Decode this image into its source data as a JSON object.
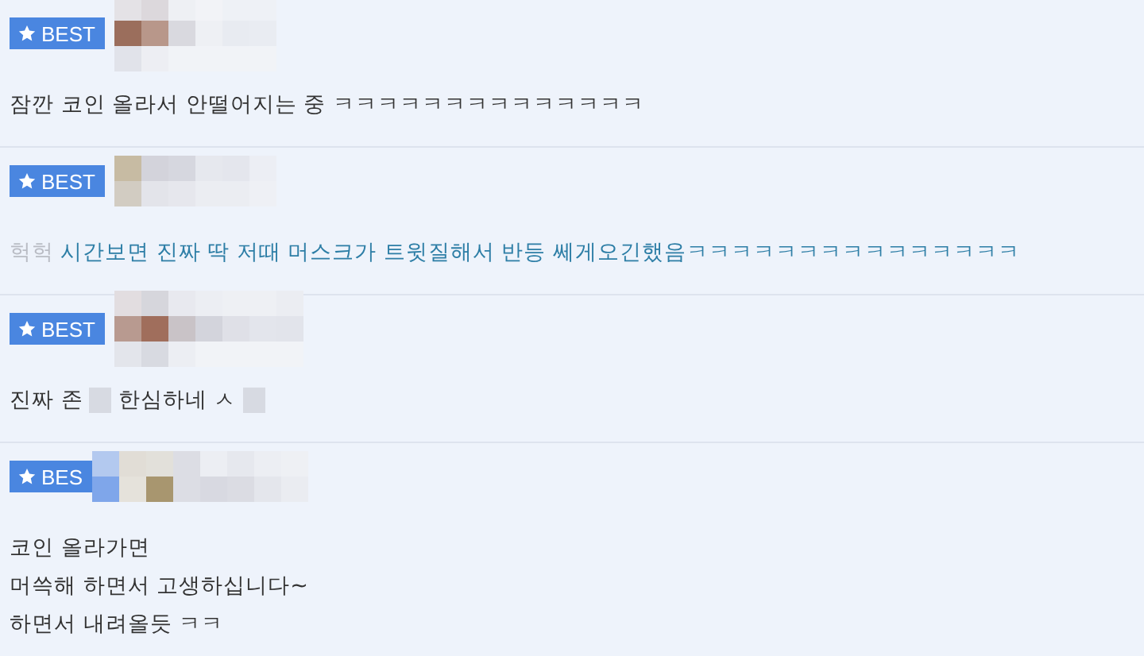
{
  "comments": [
    {
      "badge": "BEST",
      "lines": [
        [
          {
            "kind": "text",
            "text": "잠깐 코인 올라서 안떨어지는 중 ㅋㅋㅋㅋㅋㅋㅋㅋㅋㅋㅋㅋㅋㅋ"
          }
        ]
      ]
    },
    {
      "badge": "BEST",
      "lines": [
        [
          {
            "kind": "muted",
            "text": "헉헉"
          },
          {
            "kind": "link",
            "text": "시간보면 진짜 딱 저때 머스크가 트윗질해서 반등 쎄게오긴했음ㅋㅋㅋㅋㅋㅋㅋㅋㅋㅋㅋㅋㅋㅋㅋ"
          }
        ]
      ]
    },
    {
      "badge": "BEST",
      "lines": [
        [
          {
            "kind": "text",
            "text": "진짜 존"
          },
          {
            "kind": "censored"
          },
          {
            "kind": "text",
            "text": "한심하네 ㅅ"
          },
          {
            "kind": "censored"
          }
        ]
      ]
    },
    {
      "badge": "BES",
      "lines": [
        [
          {
            "kind": "text",
            "text": "코인 올라가면"
          }
        ],
        [
          {
            "kind": "text",
            "text": "머쓱해 하면서 고생하십니다~"
          }
        ],
        [
          {
            "kind": "text",
            "text": "하면서 내려올듯 ㅋㅋ"
          }
        ]
      ]
    }
  ]
}
